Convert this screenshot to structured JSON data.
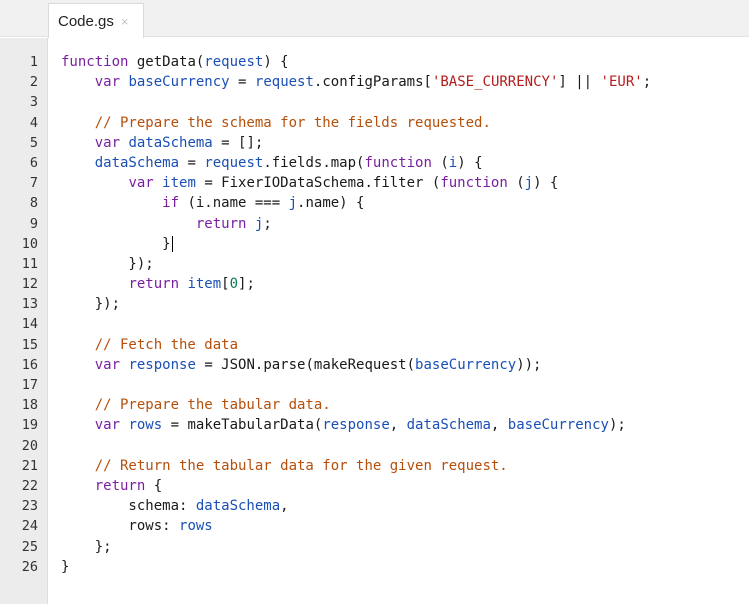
{
  "tab": {
    "label": "Code.gs",
    "close_icon": "×"
  },
  "cursor_line": 10,
  "lines": [
    [
      [
        "kw",
        "function"
      ],
      [
        "p",
        " getData("
      ],
      [
        "var",
        "request"
      ],
      [
        "p",
        ") {"
      ]
    ],
    [
      [
        "p",
        "    "
      ],
      [
        "kw",
        "var"
      ],
      [
        "p",
        " "
      ],
      [
        "var",
        "baseCurrency"
      ],
      [
        "p",
        " = "
      ],
      [
        "var",
        "request"
      ],
      [
        "p",
        ".configParams["
      ],
      [
        "str",
        "'BASE_CURRENCY'"
      ],
      [
        "p",
        "] || "
      ],
      [
        "str",
        "'EUR'"
      ],
      [
        "p",
        ";"
      ]
    ],
    [],
    [
      [
        "p",
        "    "
      ],
      [
        "cm",
        "// Prepare the schema for the fields requested."
      ]
    ],
    [
      [
        "p",
        "    "
      ],
      [
        "kw",
        "var"
      ],
      [
        "p",
        " "
      ],
      [
        "var",
        "dataSchema"
      ],
      [
        "p",
        " = [];"
      ]
    ],
    [
      [
        "p",
        "    "
      ],
      [
        "var",
        "dataSchema"
      ],
      [
        "p",
        " = "
      ],
      [
        "var",
        "request"
      ],
      [
        "p",
        ".fields.map("
      ],
      [
        "kw",
        "function"
      ],
      [
        "p",
        " ("
      ],
      [
        "var",
        "i"
      ],
      [
        "p",
        ") {"
      ]
    ],
    [
      [
        "p",
        "        "
      ],
      [
        "kw",
        "var"
      ],
      [
        "p",
        " "
      ],
      [
        "var",
        "item"
      ],
      [
        "p",
        " = FixerIODataSchema.filter ("
      ],
      [
        "kw",
        "function"
      ],
      [
        "p",
        " ("
      ],
      [
        "var",
        "j"
      ],
      [
        "p",
        ") {"
      ]
    ],
    [
      [
        "p",
        "            "
      ],
      [
        "kw",
        "if"
      ],
      [
        "p",
        " (i.name === "
      ],
      [
        "var",
        "j"
      ],
      [
        "p",
        ".name) {"
      ]
    ],
    [
      [
        "p",
        "                "
      ],
      [
        "kw",
        "return"
      ],
      [
        "p",
        " "
      ],
      [
        "var",
        "j"
      ],
      [
        "p",
        ";"
      ]
    ],
    [
      [
        "p",
        "            }"
      ]
    ],
    [
      [
        "p",
        "        });"
      ]
    ],
    [
      [
        "p",
        "        "
      ],
      [
        "kw",
        "return"
      ],
      [
        "p",
        " "
      ],
      [
        "var",
        "item"
      ],
      [
        "p",
        "["
      ],
      [
        "num",
        "0"
      ],
      [
        "p",
        "];"
      ]
    ],
    [
      [
        "p",
        "    });"
      ]
    ],
    [],
    [
      [
        "p",
        "    "
      ],
      [
        "cm",
        "// Fetch the data"
      ]
    ],
    [
      [
        "p",
        "    "
      ],
      [
        "kw",
        "var"
      ],
      [
        "p",
        " "
      ],
      [
        "var",
        "response"
      ],
      [
        "p",
        " = JSON.parse(makeRequest("
      ],
      [
        "var",
        "baseCurrency"
      ],
      [
        "p",
        "));"
      ]
    ],
    [],
    [
      [
        "p",
        "    "
      ],
      [
        "cm",
        "// Prepare the tabular data."
      ]
    ],
    [
      [
        "p",
        "    "
      ],
      [
        "kw",
        "var"
      ],
      [
        "p",
        " "
      ],
      [
        "var",
        "rows"
      ],
      [
        "p",
        " = makeTabularData("
      ],
      [
        "var",
        "response"
      ],
      [
        "p",
        ", "
      ],
      [
        "var",
        "dataSchema"
      ],
      [
        "p",
        ", "
      ],
      [
        "var",
        "baseCurrency"
      ],
      [
        "p",
        ");"
      ]
    ],
    [],
    [
      [
        "p",
        "    "
      ],
      [
        "cm",
        "// Return the tabular data for the given request."
      ]
    ],
    [
      [
        "p",
        "    "
      ],
      [
        "kw",
        "return"
      ],
      [
        "p",
        " {"
      ]
    ],
    [
      [
        "p",
        "        schema: "
      ],
      [
        "var",
        "dataSchema"
      ],
      [
        "p",
        ","
      ]
    ],
    [
      [
        "p",
        "        rows: "
      ],
      [
        "var",
        "rows"
      ]
    ],
    [
      [
        "p",
        "    };"
      ]
    ],
    [
      [
        "p",
        "}"
      ]
    ]
  ]
}
